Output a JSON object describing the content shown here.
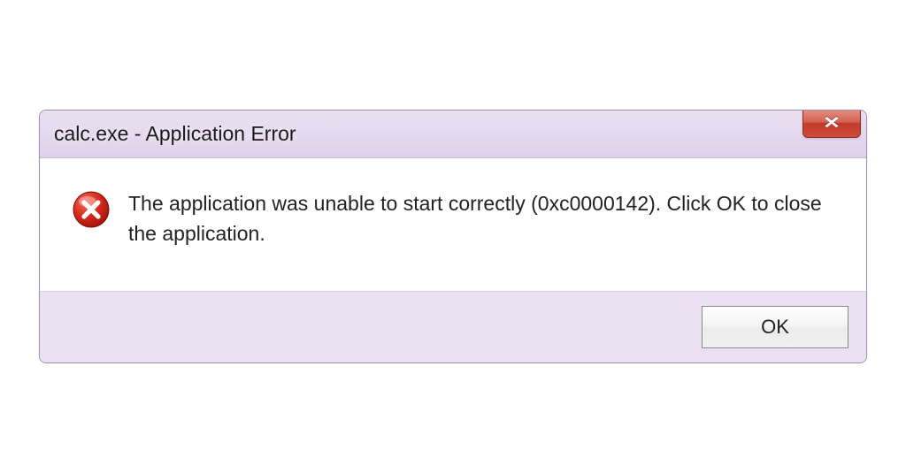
{
  "dialog": {
    "title": "calc.exe - Application Error",
    "message": "The application was unable to start correctly (0xc0000142). Click OK to close the application.",
    "ok_label": "OK"
  }
}
